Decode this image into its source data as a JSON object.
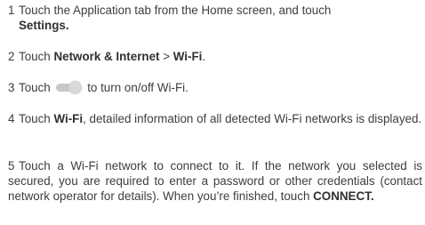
{
  "steps": [
    {
      "num": "1",
      "a": "Touch the Application tab from the Home screen, and touch",
      "b_bold": "Settings."
    },
    {
      "num": "2",
      "a": "Touch ",
      "b_bold": "Network & Internet",
      "c": " > ",
      "d_bold": "Wi-Fi",
      "e": "."
    },
    {
      "num": "3",
      "a": "Touch",
      "b": "to turn on/off Wi-Fi.",
      "icon": "toggle-switch-icon"
    },
    {
      "num": "4",
      "a": "Touch ",
      "b_bold": "Wi-Fi",
      "c": ", detailed information of all detected Wi-Fi networks is displayed."
    },
    {
      "num": "5",
      "a": "Touch a Wi-Fi network to connect to it. If the network you selected is secured, you are required to enter a password or other credentials (contact network operator for details). When you’re finished, touch ",
      "b_bold": "CONNECT."
    }
  ]
}
